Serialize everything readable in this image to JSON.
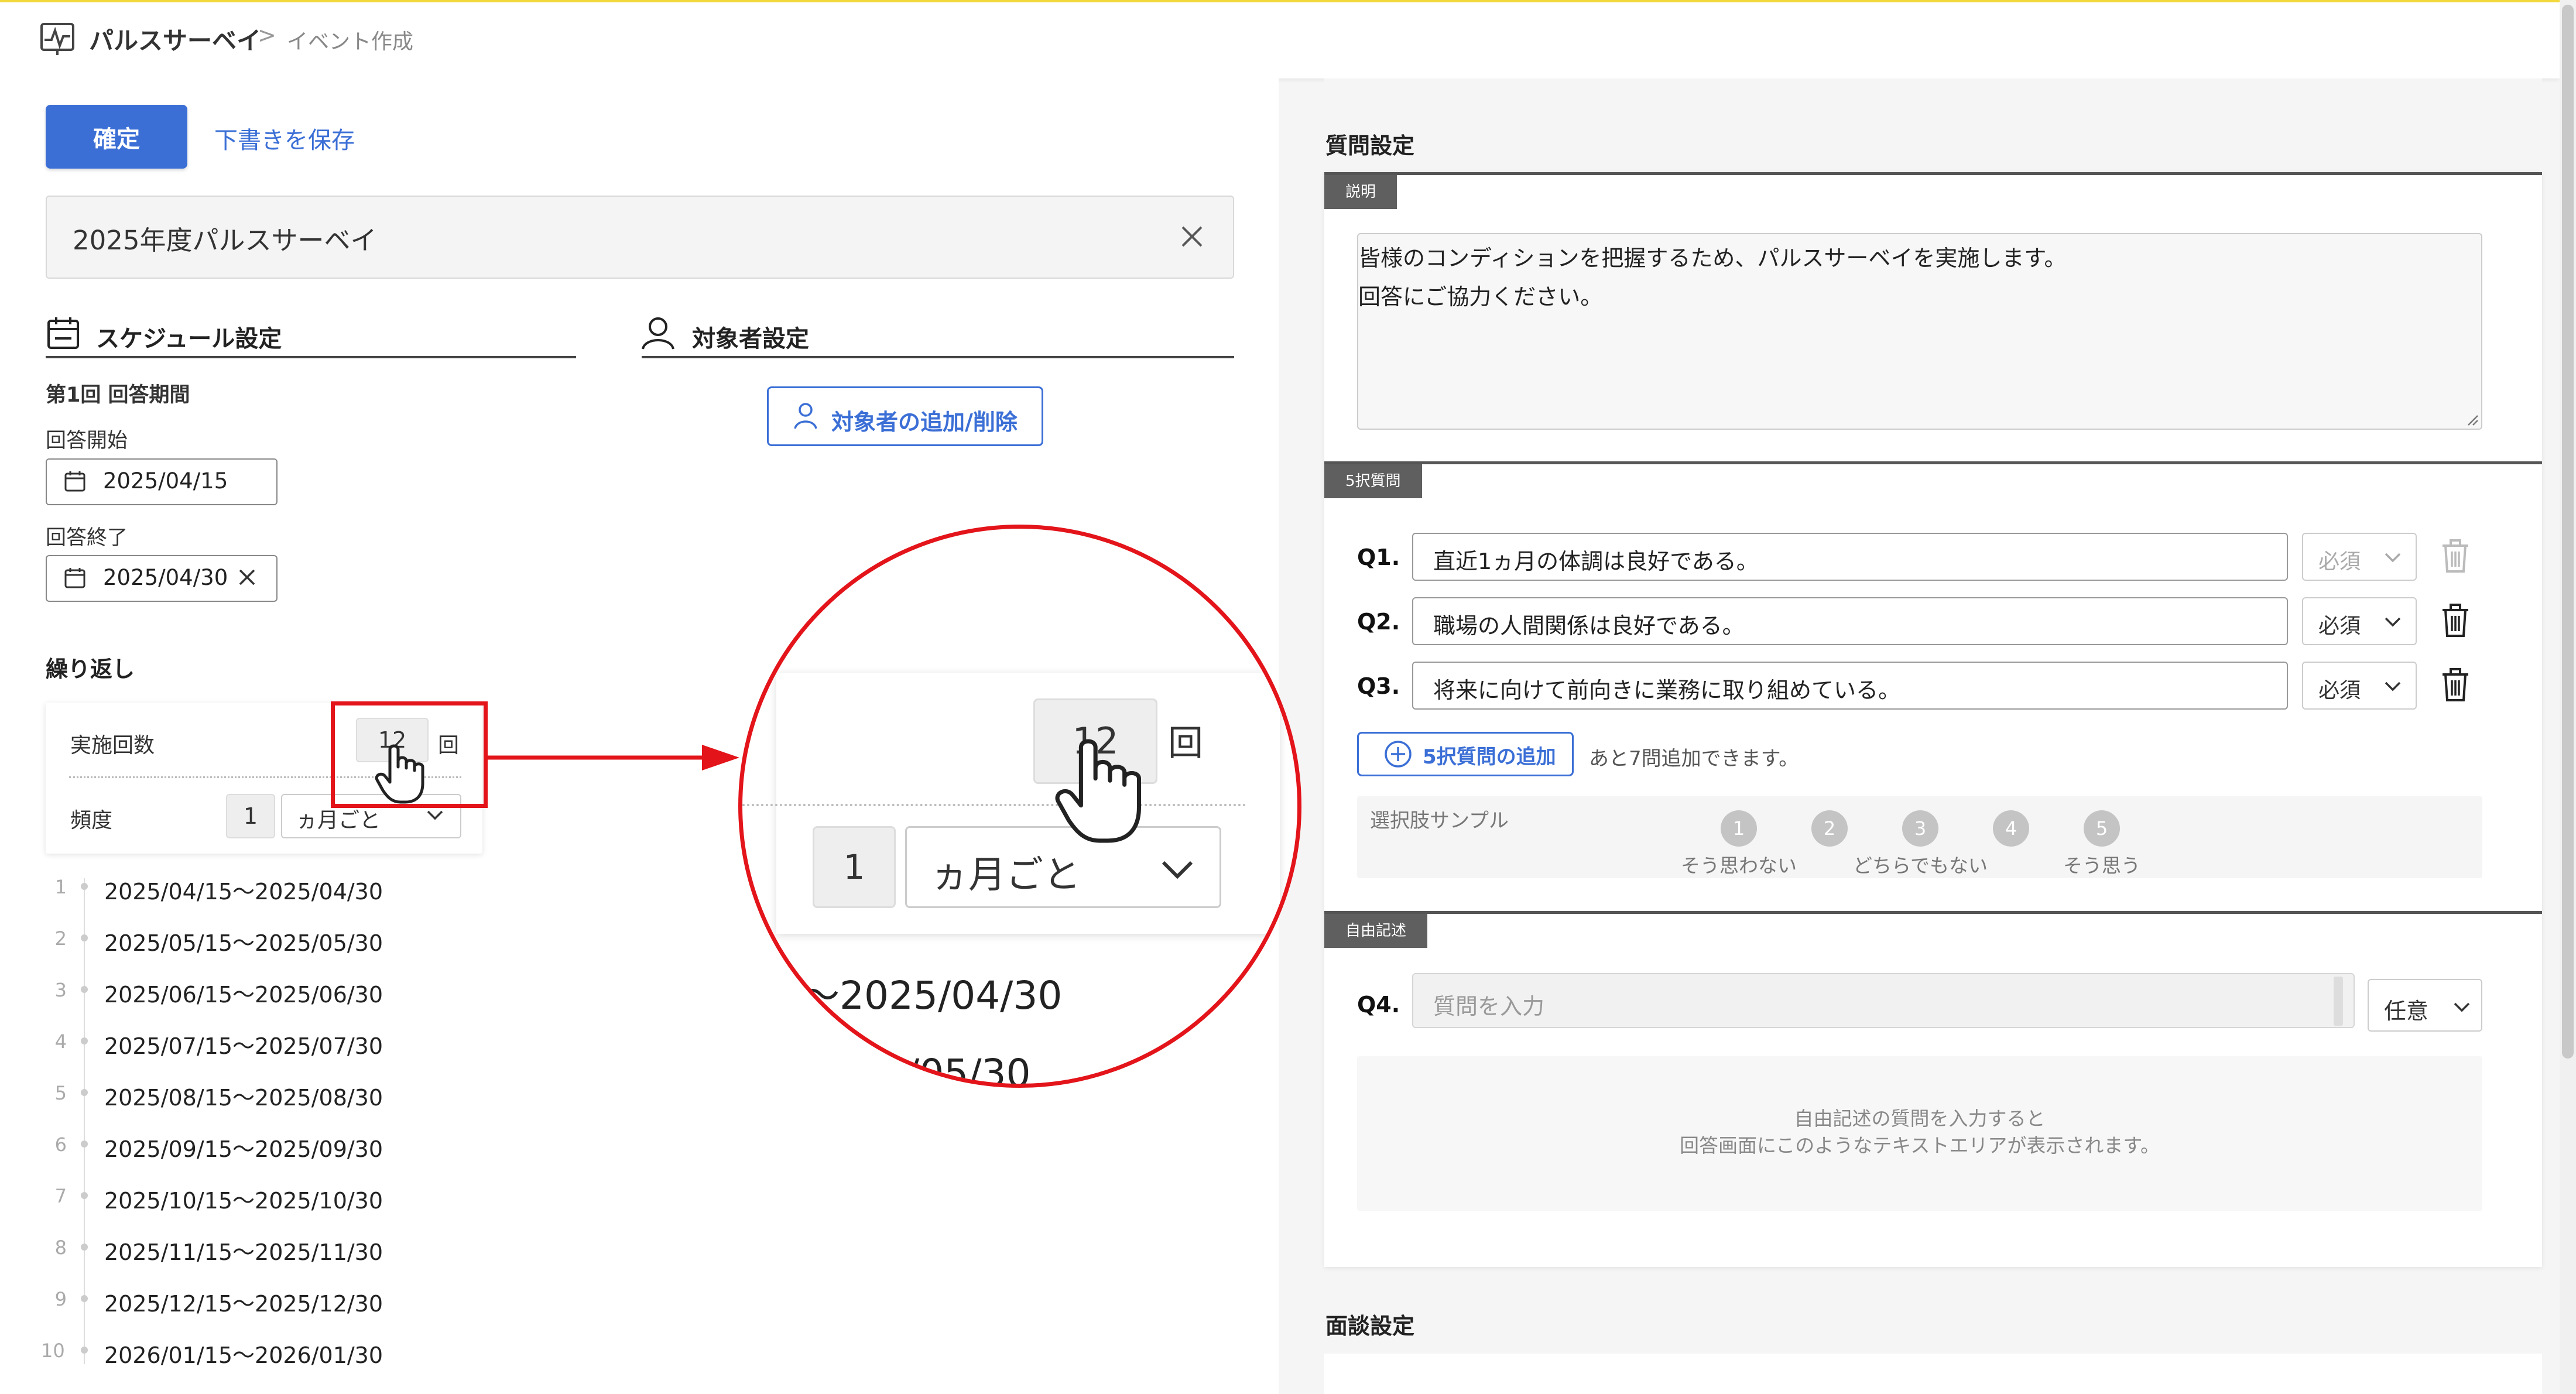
{
  "header": {
    "app_title": "パルスサーベイ",
    "separator": ">",
    "current_page": "イベント作成"
  },
  "toolbar": {
    "confirm_label": "確定",
    "draft_label": "下書きを保存"
  },
  "event_title": {
    "value": "2025年度パルスサーベイ"
  },
  "schedule": {
    "heading": "スケジュール設定",
    "period_label": "第1回 回答期間",
    "start_label": "回答開始",
    "start_value": "2025/04/15",
    "end_label": "回答終了",
    "end_value": "2025/04/30"
  },
  "target": {
    "heading": "対象者設定",
    "button_label": "対象者の追加/削除"
  },
  "repeat": {
    "heading": "繰り返し",
    "count_label": "実施回数",
    "count_value": "12",
    "count_unit": "回",
    "freq_label": "頻度",
    "freq_value": "1",
    "freq_unit": "ヵ月ごと"
  },
  "schedule_list": [
    {
      "num": "1",
      "range": "2025/04/15〜2025/04/30"
    },
    {
      "num": "2",
      "range": "2025/05/15〜2025/05/30"
    },
    {
      "num": "3",
      "range": "2025/06/15〜2025/06/30"
    },
    {
      "num": "4",
      "range": "2025/07/15〜2025/07/30"
    },
    {
      "num": "5",
      "range": "2025/08/15〜2025/08/30"
    },
    {
      "num": "6",
      "range": "2025/09/15〜2025/09/30"
    },
    {
      "num": "7",
      "range": "2025/10/15〜2025/10/30"
    },
    {
      "num": "8",
      "range": "2025/11/15〜2025/11/30"
    },
    {
      "num": "9",
      "range": "2025/12/15〜2025/12/30"
    },
    {
      "num": "10",
      "range": "2026/01/15〜2026/01/30"
    }
  ],
  "zoom": {
    "count_value": "12",
    "count_unit": "回",
    "freq_value": "1",
    "freq_unit": "ヵ月ごと",
    "row1_text": "〜2025/04/30",
    "row2_text": "/05/30"
  },
  "questions": {
    "heading": "質問設定",
    "desc_tag": "説明",
    "desc_line1": "皆様のコンディションを把握するため、パルスサーベイを実施します。",
    "desc_line2": "回答にご協力ください。",
    "choice_tag": "5択質問",
    "items": [
      {
        "label": "Q1.",
        "text": "直近1ヵ月の体調は良好である。",
        "required": "必須"
      },
      {
        "label": "Q2.",
        "text": "職場の人間関係は良好である。",
        "required": "必須"
      },
      {
        "label": "Q3.",
        "text": "将来に向けて前向きに業務に取り組めている。",
        "required": "必須"
      }
    ],
    "add_label": "5択質問の追加",
    "remaining": "あと7問追加できます。",
    "sample_label": "選択肢サンプル",
    "scale": [
      {
        "num": "1",
        "label": "そう思わない"
      },
      {
        "num": "2",
        "label": ""
      },
      {
        "num": "3",
        "label": "どちらでもない"
      },
      {
        "num": "4",
        "label": ""
      },
      {
        "num": "5",
        "label": "そう思う"
      }
    ],
    "free_tag": "自由記述",
    "q4_label": "Q4.",
    "q4_placeholder": "質問を入力",
    "q4_optional": "任意",
    "free_preview_line1": "自由記述の質問を入力すると",
    "free_preview_line2": "回答画面にこのようなテキストエリアが表示されます。"
  },
  "interview": {
    "heading": "面談設定"
  },
  "colors": {
    "primary": "#3b6fd6",
    "highlight": "#e3141a",
    "header_accent": "#f2d83a"
  }
}
